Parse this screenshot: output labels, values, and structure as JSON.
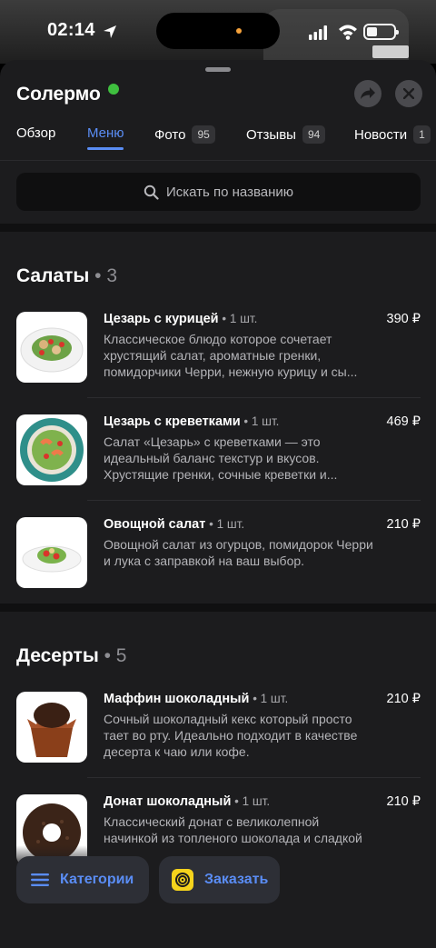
{
  "status_bar": {
    "time": "02:14"
  },
  "header": {
    "title": "Солермо"
  },
  "tabs": [
    {
      "label": "Обзор",
      "count": ""
    },
    {
      "label": "Меню",
      "count": ""
    },
    {
      "label": "Фото",
      "count": "95"
    },
    {
      "label": "Отзывы",
      "count": "94"
    },
    {
      "label": "Новости",
      "count": "1"
    }
  ],
  "search": {
    "placeholder": "Искать по названию"
  },
  "sections": [
    {
      "title": "Салаты",
      "count": "3",
      "items": [
        {
          "name": "Цезарь с курицей",
          "qty": "1 шт.",
          "price": "390 ₽",
          "desc": "Классическое блюдо которое сочетает хрустящий салат, ароматные гренки, помидорчики Черри, нежную курицу и сы..."
        },
        {
          "name": "Цезарь с креветками",
          "qty": "1 шт.",
          "price": "469 ₽",
          "desc": "Салат «Цезарь» с креветками — это идеальный баланс текстур и вкусов. Хрустящие гренки, сочные креветки и..."
        },
        {
          "name": "Овощной салат",
          "qty": "1 шт.",
          "price": "210 ₽",
          "desc": "Овощной салат из огурцов, помидорок Черри и лука с заправкой на ваш выбор."
        }
      ]
    },
    {
      "title": "Десерты",
      "count": "5",
      "items": [
        {
          "name": "Маффин шоколадный",
          "qty": "1 шт.",
          "price": "210 ₽",
          "desc": "Сочный шоколадный кекс который просто тает во рту. Идеально подходит в качестве десерта к чаю или кофе."
        },
        {
          "name": "Донат шоколадный",
          "qty": "1 шт.",
          "price": "210 ₽",
          "desc": "Классический донат с великолепной начинкой из топленого шоколада и сладкой"
        }
      ]
    }
  ],
  "bottom": {
    "categories_label": "Категории",
    "order_label": "Заказать"
  },
  "colors": {
    "accent": "#5a8df5",
    "background": "#1c1c1e",
    "order_icon": "#f5d31c"
  }
}
